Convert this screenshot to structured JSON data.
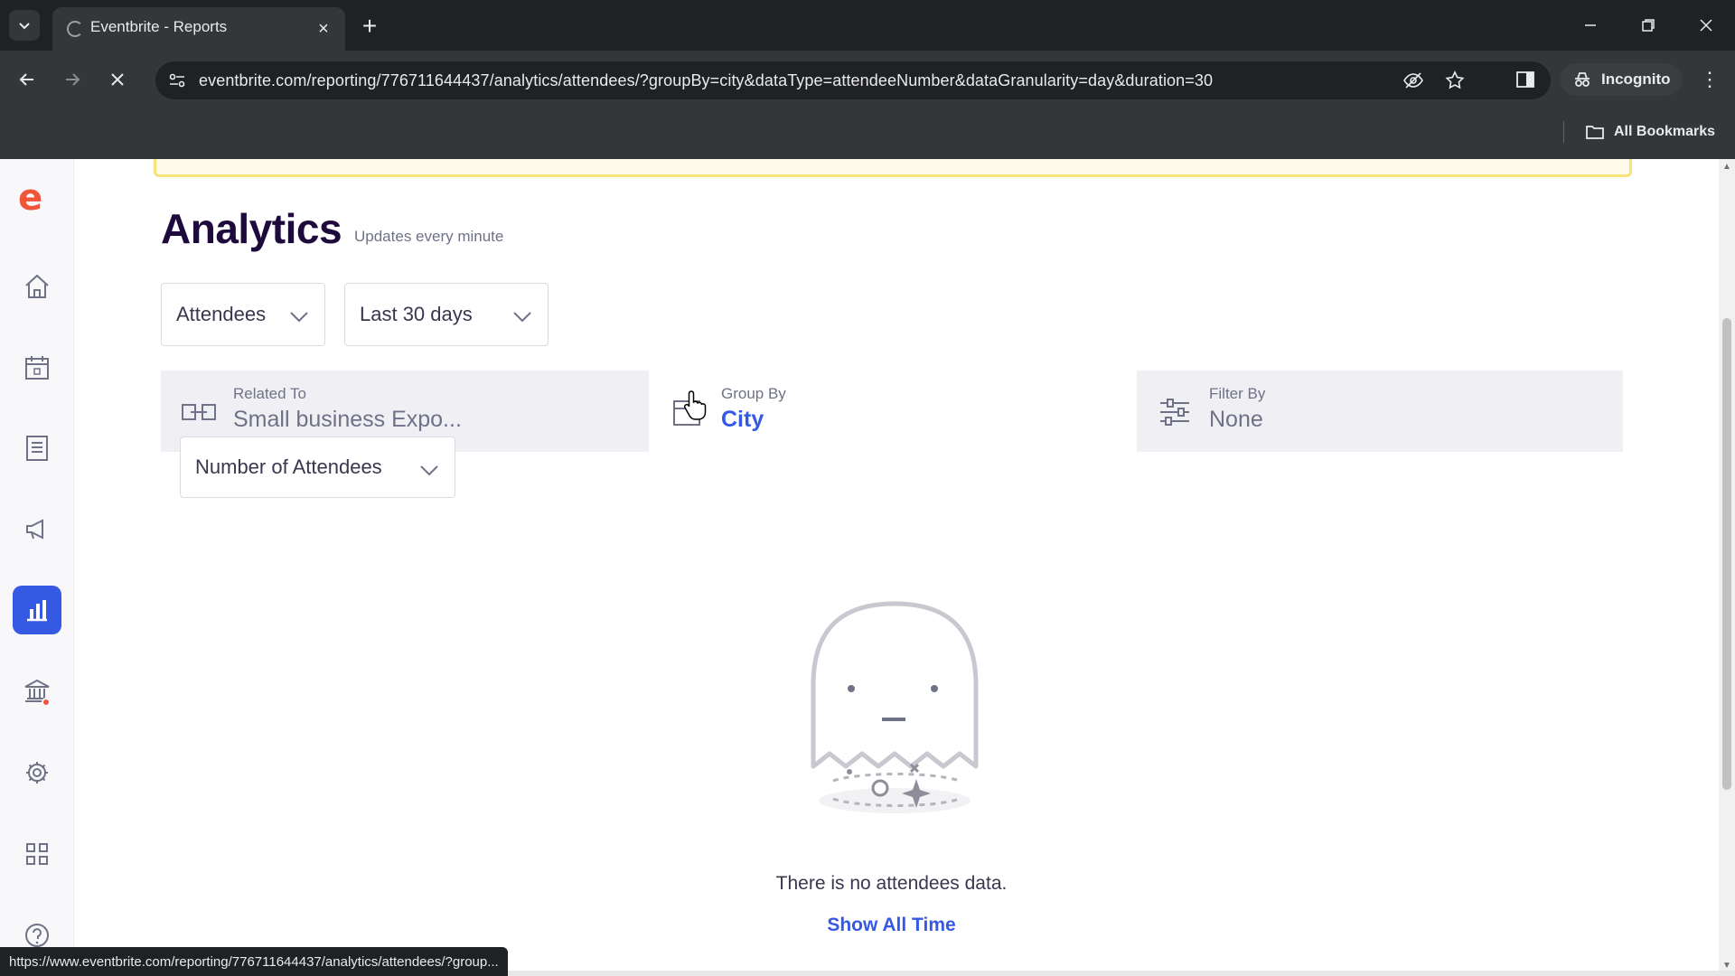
{
  "browser": {
    "tab_title": "Eventbrite - Reports",
    "url": "eventbrite.com/reporting/776711644437/analytics/attendees/?groupBy=city&dataType=attendeeNumber&dataGranularity=day&duration=30",
    "incognito_label": "Incognito",
    "bookmarks_label": "All Bookmarks",
    "status_url": "https://www.eventbrite.com/reporting/776711644437/analytics/attendees/?group..."
  },
  "sidebar": {
    "logo": "e",
    "items": [
      {
        "name": "home-icon"
      },
      {
        "name": "calendar-icon"
      },
      {
        "name": "orders-icon"
      },
      {
        "name": "megaphone-icon"
      },
      {
        "name": "analytics-icon",
        "active": true
      },
      {
        "name": "finance-icon",
        "notification": true
      },
      {
        "name": "settings-icon"
      },
      {
        "name": "apps-icon"
      },
      {
        "name": "help-icon"
      }
    ]
  },
  "main": {
    "title": "Analytics",
    "subtitle": "Updates every minute",
    "report_type": "Attendees",
    "date_range": "Last 30 days",
    "related_to": {
      "label": "Related To",
      "value": "Small business Expo..."
    },
    "group_by": {
      "label": "Group By",
      "value": "City"
    },
    "filter_by": {
      "label": "Filter By",
      "value": "None"
    },
    "metric": "Number of Attendees",
    "empty_message": "There is no attendees data.",
    "show_all_label": "Show All Time"
  },
  "colors": {
    "brand": "#f05537",
    "accent": "#3659e3",
    "text_dark": "#1e0a3c"
  }
}
